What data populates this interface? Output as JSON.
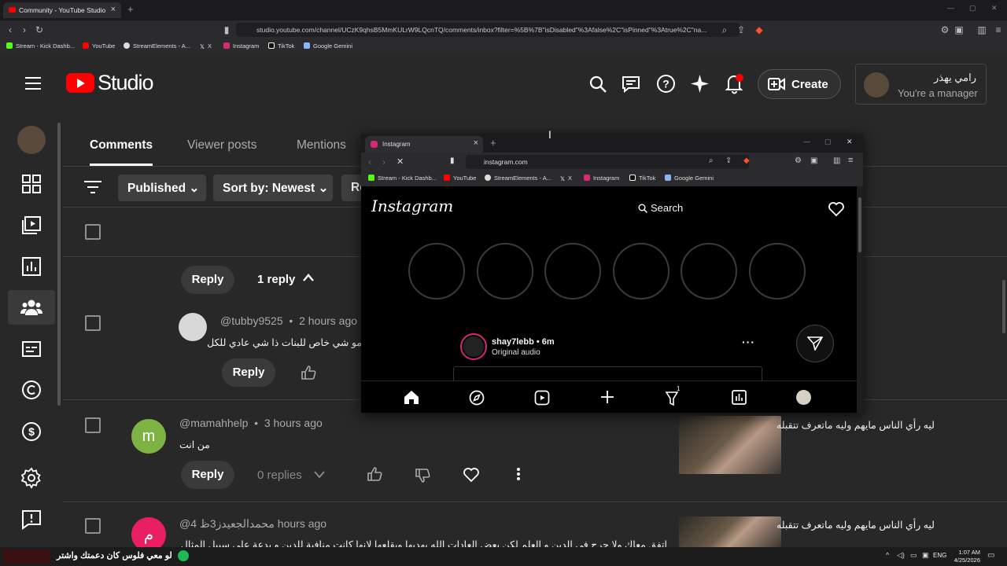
{
  "browser": {
    "tab_title": "Community - YouTube Studio",
    "url": "studio.youtube.com/channel/UCzK9qhsB5MmKULrW9LQcnTQ/comments/inbox?filter=%5B%7B\"isDisabled\"%3Afalse%2C\"isPinned\"%3Atrue%2C\"na...",
    "bookmarks": [
      "Stream - Kick Dashb...",
      "YouTube",
      "StreamElements - A...",
      "X",
      "Instagram",
      "TikTok",
      "Google Gemini"
    ]
  },
  "studio": {
    "logo_text": "Studio",
    "create_label": "Create",
    "account_name": "رامي يهذر",
    "account_role": "You're a manager",
    "tabs": [
      "Comments",
      "Viewer posts",
      "Mentions"
    ],
    "filters": {
      "published": "Published",
      "sort": "Sort by: Newest",
      "partial": "Re"
    },
    "reply_label": "Reply",
    "one_reply": "1 reply",
    "comments": [
      {
        "author": "@tubby9525",
        "time": "2 hours ago",
        "text": "مو شي خاص للبنات ذا شي عادي للكل"
      },
      {
        "author": "@mamahhelp",
        "time": "3 hours ago",
        "text": "من انت",
        "avatar_letter": "m",
        "avatar_color": "#7cb342",
        "replies": "0 replies",
        "video_title": "ليه رأي الناس مايهم وليه ماتعرف تتقبله"
      },
      {
        "author": "@4",
        "author_suffix": "محمدالجعيدز3ظ",
        "time": "hours ago",
        "text": "اتفق معاك ولا حرج في الدين و العلم لكن بعض العادات الله يهديها ويقلعها لانها كانت منافية للدين و بدعة على سبيل المثال الزمان أباد",
        "avatar_letter": "م",
        "avatar_color": "#e91e63",
        "video_title": "ليه رأي الناس مايهم وليه ماتعرف تتقبله"
      }
    ]
  },
  "popup": {
    "tab_title": "Instagram",
    "url": "instagram.com",
    "bookmarks": [
      "Stream - Kick Dashb...",
      "YouTube",
      "StreamElements - A...",
      "X",
      "Instagram",
      "TikTok",
      "Google Gemini"
    ],
    "ig_logo": "Instagram",
    "search_label": "Search",
    "post_user": "shay7lebb • 6m",
    "post_audio": "Original audio",
    "notif_count": "1"
  },
  "taskbar": {
    "left_text": "لو معي فلوس كان دعمتك واشتر",
    "lang": "ENG",
    "time": "1:07 AM",
    "date": "4/25/2026"
  },
  "colors": {
    "yt_red": "#ff0000",
    "bg": "#282828",
    "brave_orange": "#fb542b"
  }
}
